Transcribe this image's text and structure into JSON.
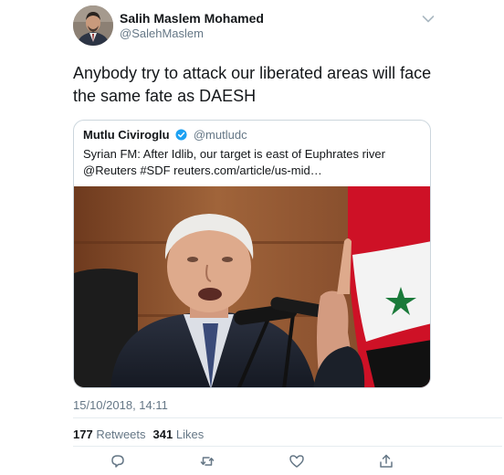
{
  "author": {
    "name": "Salih Maslem Mohamed",
    "handle": "@SalehMaslem"
  },
  "tweet_text": "Anybody try to attack our liberated areas will face the same fate as DAESH",
  "quoted_tweet": {
    "name": "Mutlu Civiroglu",
    "handle": "@mutludc",
    "text": "Syrian FM: After Idlib, our target is east of Euphrates river @Reuters #SDF reuters.com/article/us-mid…"
  },
  "timestamp": "15/10/2018, 14:11",
  "stats": {
    "retweets_count": "177",
    "retweets_label": "Retweets",
    "likes_count": "341",
    "likes_label": "Likes"
  },
  "icons": {
    "menu": "chevron-down-icon",
    "verified": "verified-badge-icon",
    "reply": "reply-icon",
    "retweet": "retweet-icon",
    "like": "heart-icon",
    "share": "share-icon"
  },
  "colors": {
    "text": "#14171a",
    "secondary": "#657786",
    "border": "#ccd6dd",
    "verified": "#1da1f2",
    "flag_red": "#ce1126"
  }
}
